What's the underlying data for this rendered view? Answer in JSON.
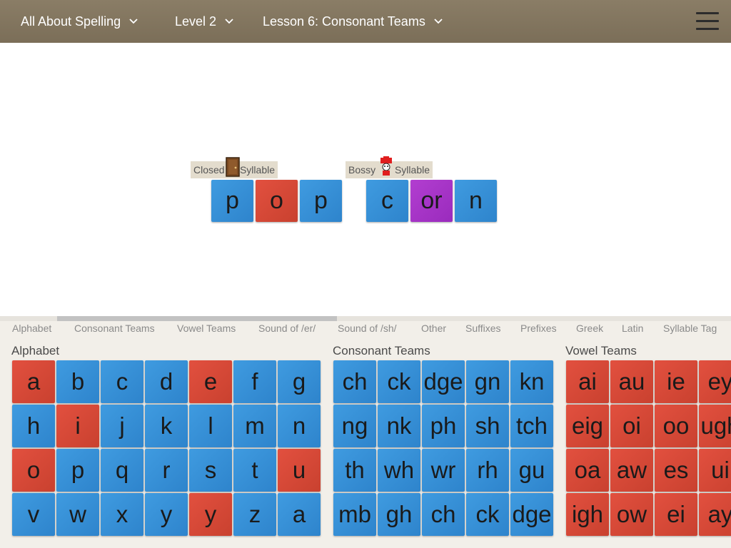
{
  "header": {
    "program": "All About Spelling",
    "level": "Level 2",
    "lesson": "Lesson 6: Consonant Teams"
  },
  "words": [
    {
      "syllable_label_left": "Closed",
      "syllable_label_right": "Syllable",
      "icon": "door-icon",
      "tiles": [
        {
          "text": "p",
          "color": "blue"
        },
        {
          "text": "o",
          "color": "red"
        },
        {
          "text": "p",
          "color": "blue"
        }
      ]
    },
    {
      "syllable_label_left": "Bossy",
      "syllable_label_right": "Syllable",
      "icon": "bossy-r-icon",
      "tiles": [
        {
          "text": "c",
          "color": "blue"
        },
        {
          "text": "or",
          "color": "purple"
        },
        {
          "text": "n",
          "color": "blue"
        }
      ]
    }
  ],
  "tabs": [
    "Alphabet",
    "Consonant Teams",
    "Vowel Teams",
    "Sound of /er/",
    "Sound of /sh/",
    "Other",
    "Suffixes",
    "Prefixes",
    "Greek",
    "Latin",
    "Syllable Tag"
  ],
  "sections": {
    "alphabet": {
      "title": "Alphabet",
      "rows": [
        [
          "a",
          "b",
          "c",
          "d",
          "e",
          "f",
          "g"
        ],
        [
          "h",
          "i",
          "j",
          "k",
          "l",
          "m",
          "n"
        ],
        [
          "o",
          "p",
          "q",
          "r",
          "s",
          "t",
          "u"
        ],
        [
          "v",
          "w",
          "x",
          "y",
          "y",
          "z",
          "a"
        ]
      ],
      "colors": [
        [
          "red",
          "blue",
          "blue",
          "blue",
          "red",
          "blue",
          "blue"
        ],
        [
          "blue",
          "red",
          "blue",
          "blue",
          "blue",
          "blue",
          "blue"
        ],
        [
          "red",
          "blue",
          "blue",
          "blue",
          "blue",
          "blue",
          "red"
        ],
        [
          "blue",
          "blue",
          "blue",
          "blue",
          "red",
          "blue",
          "blue"
        ]
      ]
    },
    "consonant_teams": {
      "title": "Consonant Teams",
      "rows": [
        [
          "ch",
          "ck",
          "dge",
          "gn",
          "kn"
        ],
        [
          "ng",
          "nk",
          "ph",
          "sh",
          "tch"
        ],
        [
          "th",
          "wh",
          "wr",
          "rh",
          "gu"
        ],
        [
          "mb",
          "gh",
          "ch",
          "ck",
          "dge"
        ]
      ]
    },
    "vowel_teams": {
      "title": "Vowel Teams",
      "rows": [
        [
          "ai",
          "au",
          "ie",
          "ey"
        ],
        [
          "eig",
          "oi",
          "oo",
          "ugh"
        ],
        [
          "oa",
          "aw",
          "es",
          "ui"
        ],
        [
          "igh",
          "ow",
          "ei",
          "ay"
        ]
      ]
    }
  },
  "colors": {
    "blue": "#3490d8",
    "red": "#d6483a",
    "purple": "#a535c8",
    "topbar": "#857860"
  }
}
